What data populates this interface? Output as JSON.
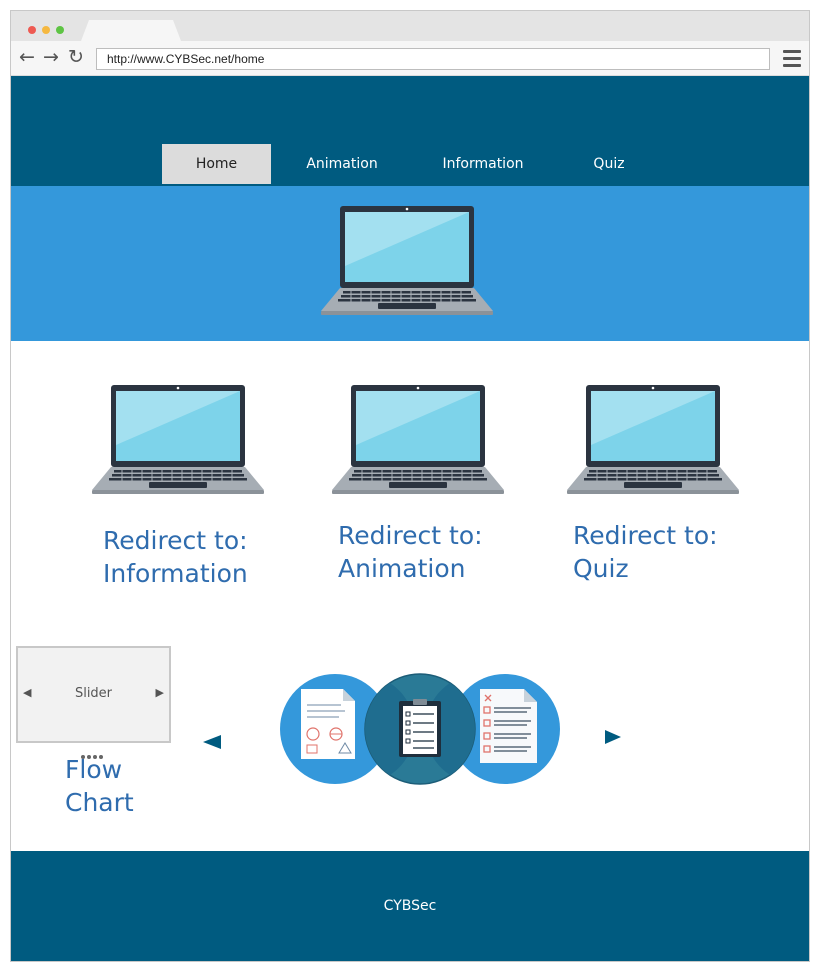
{
  "browser": {
    "url": "http://www.CYBSec.net/home",
    "traffic_colors": [
      "#ee5a52",
      "#f5b840",
      "#5ec444"
    ]
  },
  "nav": {
    "items": [
      {
        "label": "Home",
        "active": true
      },
      {
        "label": "Animation",
        "active": false
      },
      {
        "label": "Information",
        "active": false
      },
      {
        "label": "Quiz",
        "active": false
      }
    ]
  },
  "cards": [
    {
      "label": "Redirect to:\nInformation"
    },
    {
      "label": "Redirect to:\nAnimation"
    },
    {
      "label": "Redirect to:\nQuiz"
    }
  ],
  "slider": {
    "label": "Slider"
  },
  "flowchart": {
    "label": "Flow\nChart"
  },
  "footer": {
    "text": "CYBSec"
  },
  "colors": {
    "header": "#005b80",
    "hero": "#3498db",
    "link_text": "#2f6cae",
    "circle": "#3498db",
    "circle_overlap": "#2a7a96"
  }
}
